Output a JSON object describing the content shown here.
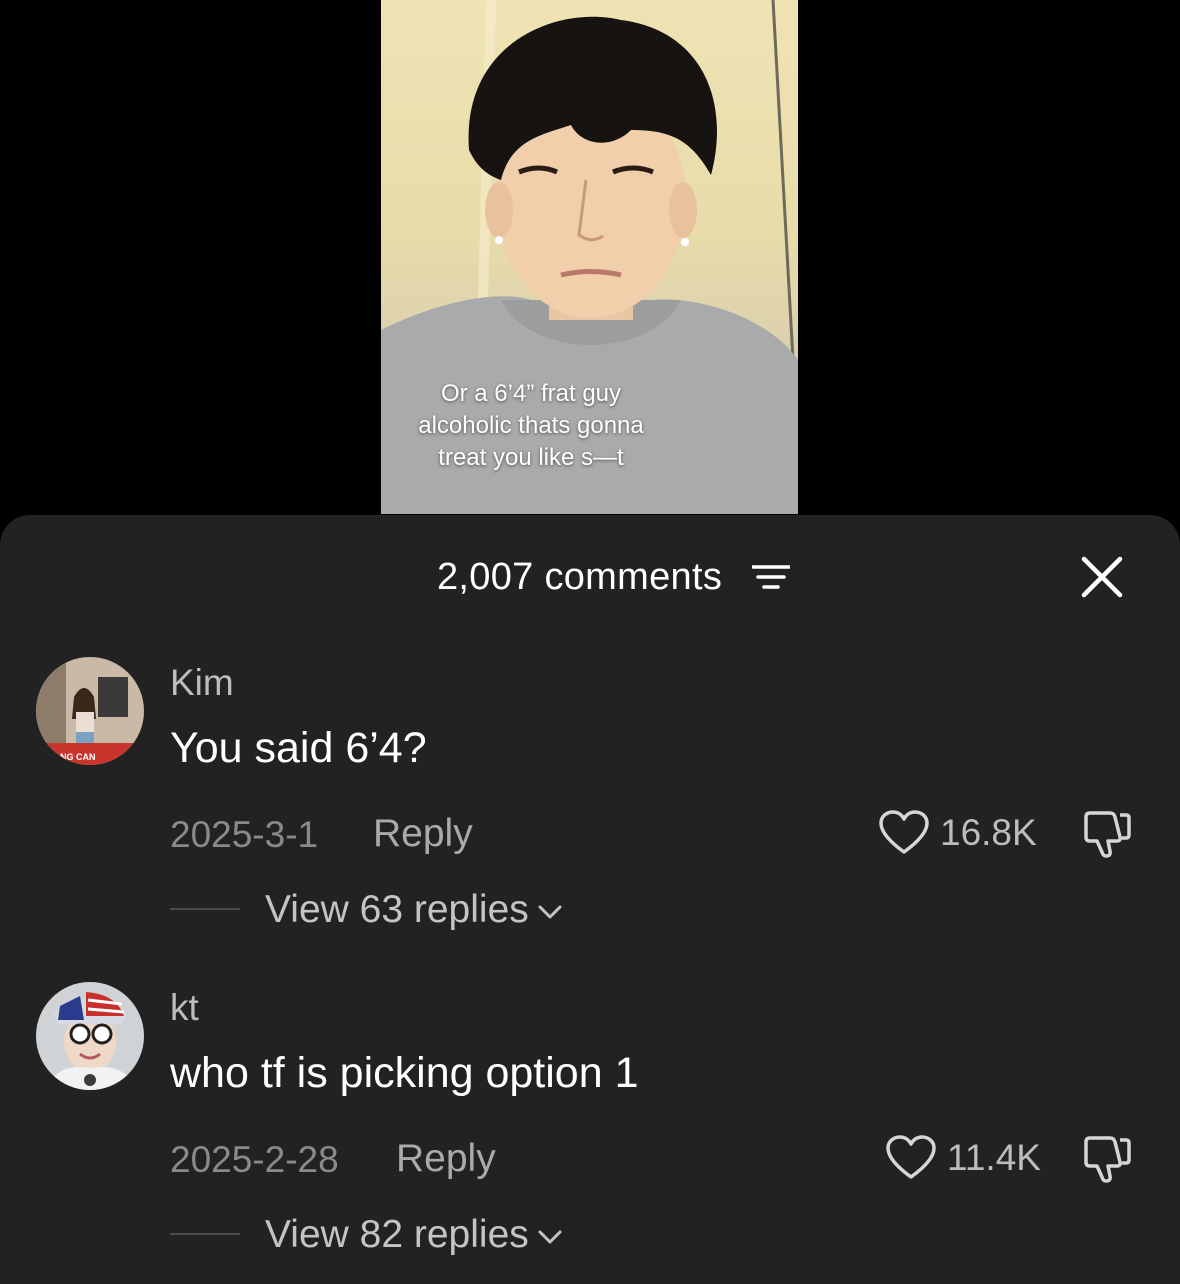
{
  "video": {
    "caption": "Or a 6’4” frat guy\nalcoholic thats gonna\ntreat you like s—t"
  },
  "comments_header": {
    "count_label": "2,007 comments",
    "filter_icon": "filter-lines-icon",
    "close_icon": "close-x-icon"
  },
  "comments": [
    {
      "username": "Kim",
      "text": "You said 6’4?",
      "date": "2025-3-1",
      "reply_label": "Reply",
      "likes": "16.8K",
      "view_replies": "View 63 replies",
      "avatar_caption": "NG CAN"
    },
    {
      "username": "kt",
      "text": "who tf is picking option 1",
      "date": "2025-2-28",
      "reply_label": "Reply",
      "likes": "11.4K",
      "view_replies": "View 82 replies"
    }
  ],
  "colors": {
    "sheet_background": "#222222",
    "page_background": "#000000",
    "primary_text": "#ffffff",
    "secondary_text": "#8a8a8a"
  }
}
